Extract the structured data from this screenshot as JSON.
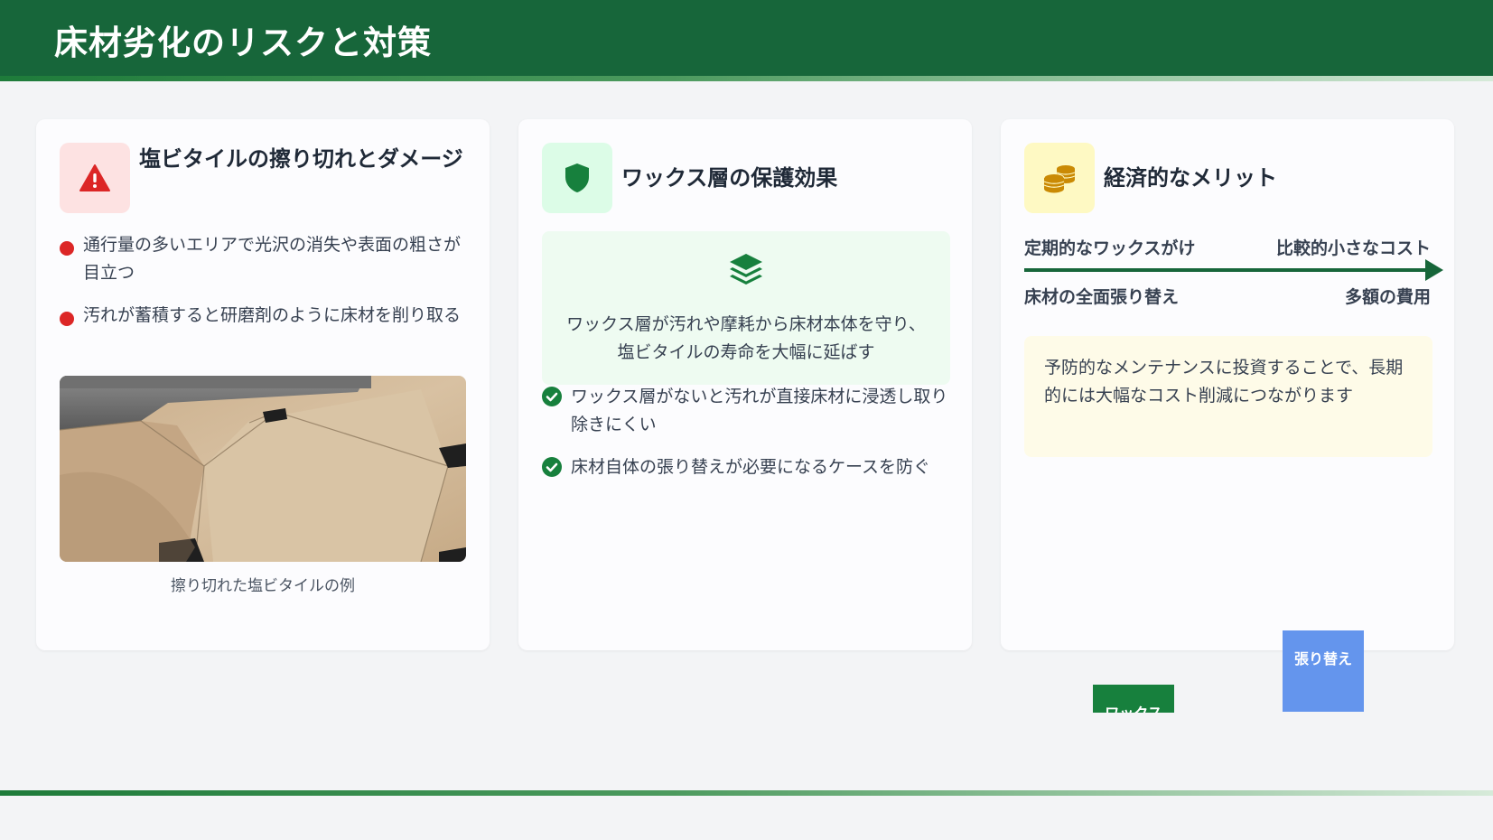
{
  "header": {
    "title": "床材劣化のリスクと対策"
  },
  "cards": [
    {
      "title": "塩ビタイルの擦り切れとダメージ",
      "icon": "warning-triangle-icon",
      "accent": "#dc2626",
      "icon_bg": "#fde2e2",
      "bullets": [
        "通行量の多いエリアで光沢の消失や表面の粗さが目立つ",
        "汚れが蓄積すると研磨剤のように床材を削り取る"
      ],
      "image_caption": "擦り切れた塩ビタイルの例"
    },
    {
      "title": "ワックス層の保護効果",
      "icon": "shield-icon",
      "accent": "#17803d",
      "icon_bg": "#dcfce7",
      "highlight_icon": "layers-icon",
      "highlight_text": "ワックス層が汚れや摩耗から床材本体を守り、塩ビタイルの寿命を大幅に延ばす",
      "bullets": [
        "ワックス層がないと汚れが直接床材に浸透し取り除きにくい",
        "床材自体の張り替えが必要になるケースを防ぐ"
      ]
    },
    {
      "title": "経済的なメリット",
      "icon": "coins-icon",
      "accent": "#ca8a04",
      "icon_bg": "#fef9c3",
      "comparison": {
        "left_top": "定期的なワックスがけ",
        "right_top": "比較的小さなコスト",
        "left_bottom": "床材の全面張り替え",
        "right_bottom": "多額の費用"
      },
      "note": "予防的なメンテナンスに投資することで、長期的には大幅なコスト削減につながります",
      "chart": {
        "bars": [
          {
            "label": "ワックス",
            "color": "#17803d"
          },
          {
            "label": "張り替え",
            "color": "#6495ed"
          }
        ]
      }
    }
  ]
}
